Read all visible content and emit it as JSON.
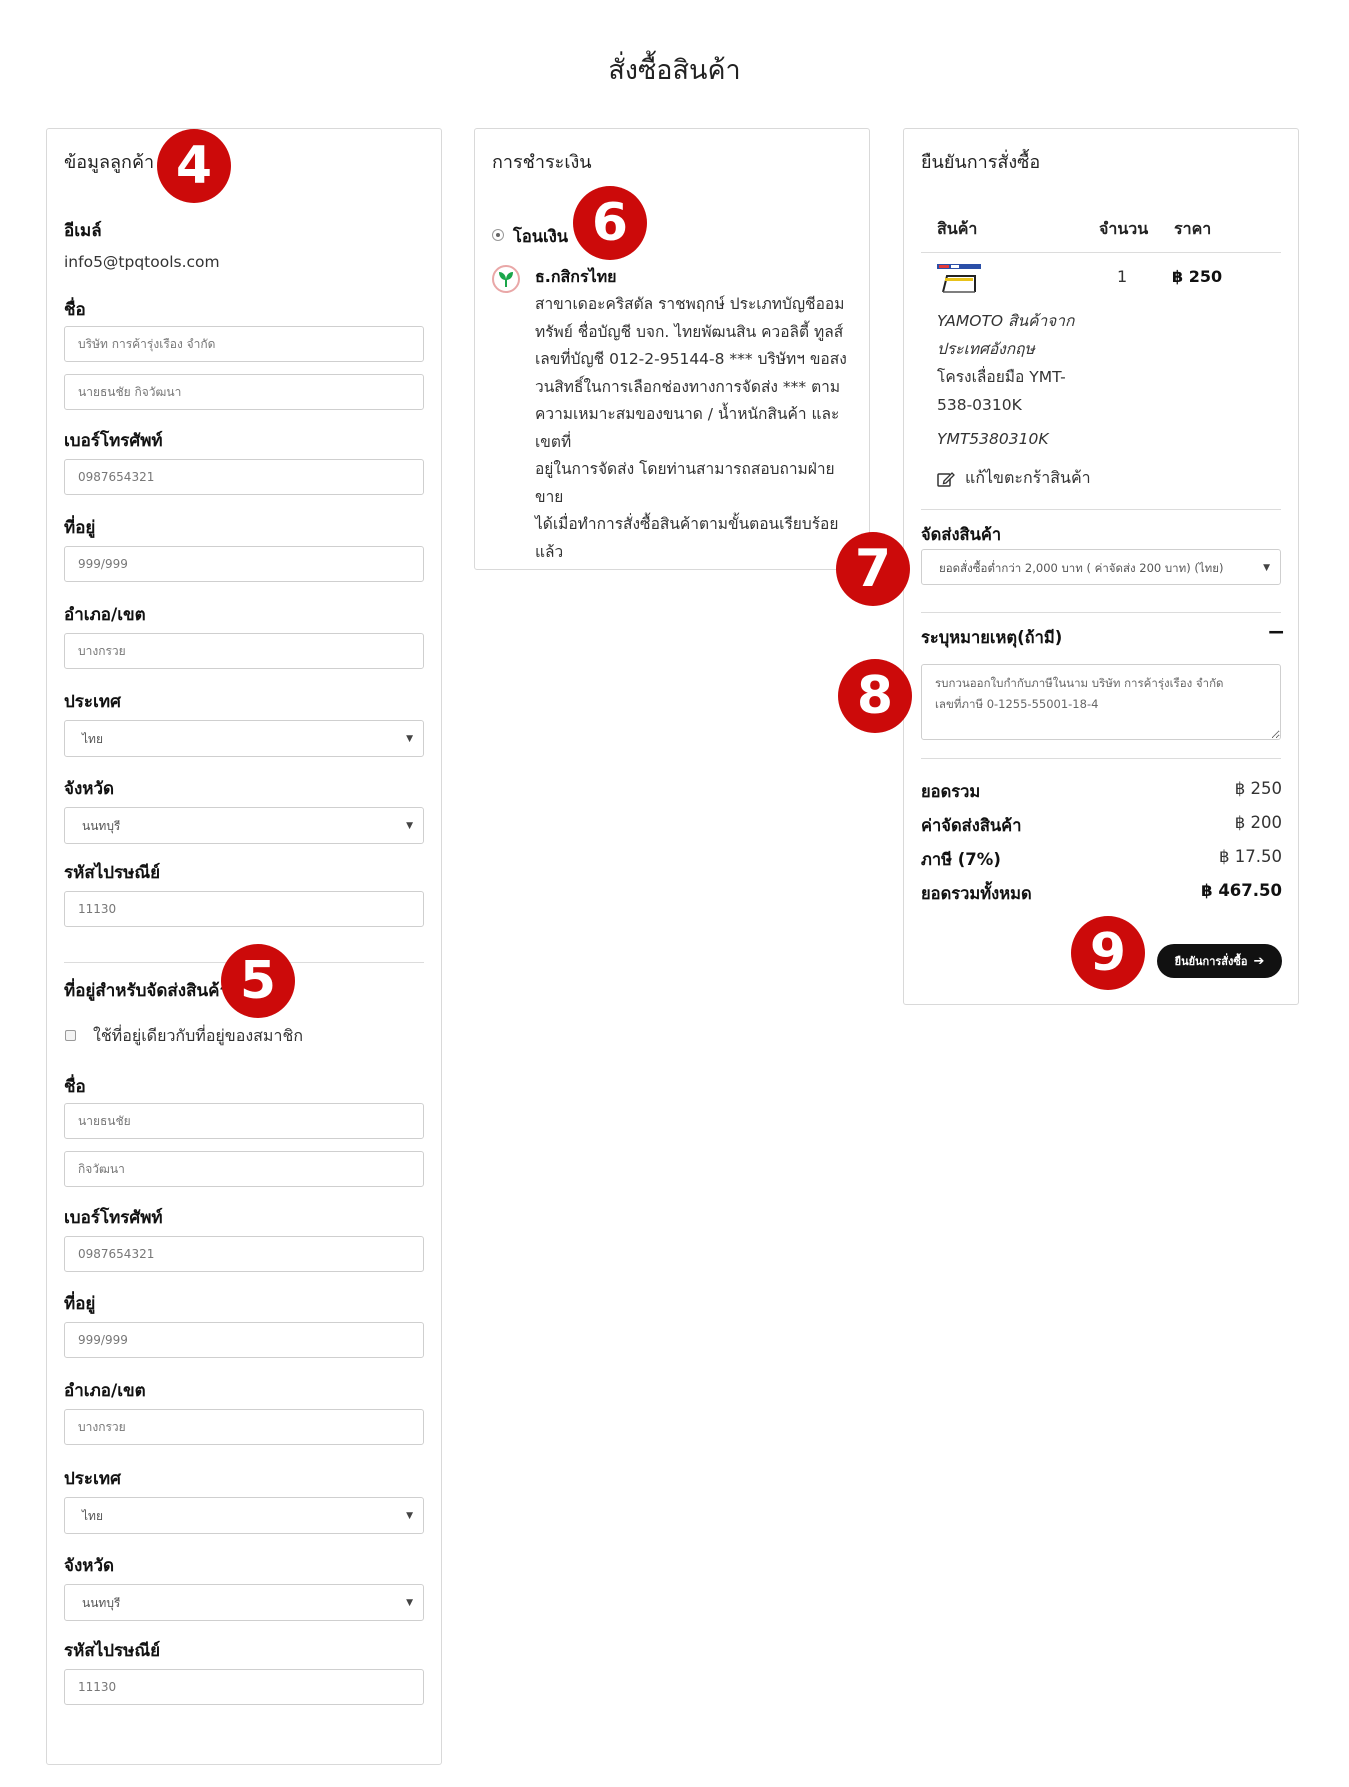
{
  "page_title": "สั่งซื้อสินค้า",
  "markers": [
    "4",
    "5",
    "6",
    "7",
    "8",
    "9"
  ],
  "customer": {
    "heading": "ข้อมูลลูกค้า",
    "email_label": "อีเมล์",
    "email_value": "info5@tpqtools.com",
    "name_label": "ชื่อ",
    "company_placeholder": "บริษัท การค้ารุ่งเรือง จำกัด",
    "person_placeholder": "นายธนชัย กิจวัฒนา",
    "phone_label": "เบอร์โทรศัพท์",
    "phone_placeholder": "0987654321",
    "address_label": "ที่อยู่",
    "address_placeholder": "999/999",
    "district_label": "อำเภอ/เขต",
    "district_placeholder": "บางกรวย",
    "country_label": "ประเทศ",
    "country_value": "ไทย",
    "province_label": "จังหวัด",
    "province_value": "นนทบุรี",
    "zip_label": "รหัสไปรษณีย์",
    "zip_placeholder": "11130"
  },
  "shipping": {
    "heading": "ที่อยู่สำหรับจัดส่งสินค้า",
    "same_address_label": "ใช้ที่อยู่เดียวกับที่อยู่ของสมาชิก",
    "name_label": "ชื่อ",
    "first_name_placeholder": "นายธนชัย",
    "last_name_placeholder": "กิจวัฒนา",
    "phone_label": "เบอร์โทรศัพท์",
    "phone_placeholder": "0987654321",
    "address_label": "ที่อยู่",
    "address_placeholder": "999/999",
    "district_label": "อำเภอ/เขต",
    "district_placeholder": "บางกรวย",
    "country_label": "ประเทศ",
    "country_value": "ไทย",
    "province_label": "จังหวัด",
    "province_value": "นนทบุรี",
    "zip_label": "รหัสไปรษณีย์",
    "zip_placeholder": "11130"
  },
  "payment": {
    "heading": "การชำระเงิน",
    "method_label": "โอนเงิน",
    "bank_name": "ธ.กสิกรไทย",
    "bank_lines": [
      "สาขาเดอะคริสตัล ราชพฤกษ์ ประเภทบัญชีออม",
      "ทรัพย์ ชื่อบัญชี บจก. ไทยพัฒนสิน ควอลิตี้ ทูลส์",
      "เลขที่บัญชี 012-2-95144-8 *** บริษัทฯ ขอสง",
      "วนสิทธิ์ในการเลือกช่องทางการจัดส่ง *** ตาม",
      "ความเหมาะสมของขนาด / น้ำหนักสินค้า และเขตที่",
      "อยู่ในการจัดส่ง โดยท่านสามารถสอบถามฝ่ายขาย",
      "ได้เมื่อทำการสั่งซื้อสินค้าตามขั้นตอนเรียบร้อยแล้ว"
    ],
    "bank_logo_icon": "kasikorn-bank-logo",
    "bank_green": "#1aa64a"
  },
  "order": {
    "heading": "ยืนยันการสั่งซื้อ",
    "col_product": "สินค้า",
    "col_qty": "จำนวน",
    "col_price": "ราคา",
    "item": {
      "qty": "1",
      "price": "฿ 250",
      "brand_line1": "YAMOTO สินค้าจาก",
      "brand_line2": "ประเทศอังกฤษ",
      "name_line1": "โครงเลื่อยมือ YMT-",
      "name_line2": "538-0310K",
      "sku": "YMT5380310K"
    },
    "edit_cart_label": "แก้ไขตะกร้าสินค้า",
    "shipping_label": "จัดส่งสินค้า",
    "shipping_option": "ยอดสั่งซื้อต่ำกว่า 2,000 บาท ( ค่าจัดส่ง 200 บาท) (ไทย)",
    "note_label": "ระบุหมายเหตุ(ถ้ามี)",
    "collapse_symbol": "−",
    "note_value": "รบกวนออกใบกำกับภาษีในนาม บริษัท การค้ารุ่งเรือง จำกัด\nเลขที่ภาษี 0-1255-55001-18-4",
    "subtotal_label": "ยอดรวม",
    "subtotal_value": "฿ 250",
    "shipping_cost_label": "ค่าจัดส่งสินค้า",
    "shipping_cost_value": "฿ 200",
    "tax_label": "ภาษี (7%)",
    "tax_value": "฿ 17.50",
    "total_label": "ยอดรวมทั้งหมด",
    "total_value": "฿ 467.50",
    "confirm_button": "ยืนยันการสั่งซื้อ",
    "confirm_arrow": "➔"
  },
  "colors": {
    "marker_red": "#cc0a0a",
    "button_black": "#111111",
    "border_gray": "#d9d9d9"
  }
}
